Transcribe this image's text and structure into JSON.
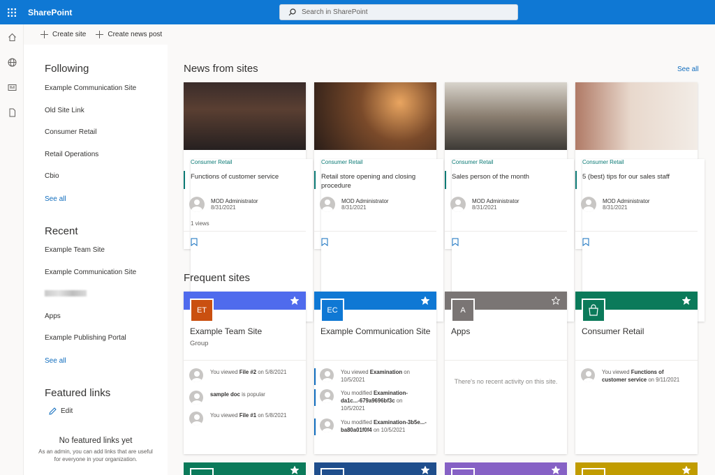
{
  "header": {
    "app_name": "SharePoint",
    "search_placeholder": "Search in SharePoint"
  },
  "rail": [
    "home-icon",
    "globe-icon",
    "news-icon",
    "document-icon"
  ],
  "command_bar": {
    "create_site": "Create site",
    "create_news": "Create news post"
  },
  "following": {
    "heading": "Following",
    "items": [
      {
        "label": "Example Communication Site",
        "starred": true
      },
      {
        "label": "Old Site Link",
        "starred": true
      },
      {
        "label": "Consumer Retail",
        "starred": true
      },
      {
        "label": "Retail Operations",
        "starred": true
      },
      {
        "label": "Cbio",
        "starred": true
      }
    ],
    "see_all": "See all"
  },
  "recent": {
    "heading": "Recent",
    "items": [
      {
        "label": "Example Team Site",
        "starred": false
      },
      {
        "label": "Example Communication Site",
        "starred": true
      },
      {
        "label": "",
        "starred": false,
        "blurred": true
      },
      {
        "label": "Apps",
        "starred": false
      },
      {
        "label": "Example Publishing Portal",
        "starred": false
      }
    ],
    "see_all": "See all"
  },
  "featured": {
    "heading": "Featured links",
    "edit": "Edit",
    "empty_title": "No featured links yet",
    "empty_desc": "As an admin, you can add links that are useful for everyone in your organization."
  },
  "news": {
    "heading": "News from sites",
    "see_all": "See all",
    "cards": [
      {
        "site": "Consumer Retail",
        "title": "Functions of customer service",
        "author": "MOD Administrator",
        "date": "8/31/2021",
        "views": "1 views"
      },
      {
        "site": "Consumer Retail",
        "title": "Retail store opening and closing procedure",
        "author": "MOD Administrator",
        "date": "8/31/2021",
        "views": ""
      },
      {
        "site": "Consumer Retail",
        "title": "Sales person of the month",
        "author": "MOD Administrator",
        "date": "8/31/2021",
        "views": ""
      },
      {
        "site": "Consumer Retail",
        "title": "5 (best) tips for our sales staff",
        "author": "MOD Administrator",
        "date": "8/31/2021",
        "views": ""
      }
    ]
  },
  "frequent": {
    "heading": "Frequent sites",
    "no_activity": "There's no recent activity on this site.",
    "sites": [
      {
        "name": "Example Team Site",
        "type": "Group",
        "initials": "ET",
        "band_color": "#4f6bed",
        "logo_color": "#ca5010"
      },
      {
        "name": "Example Communication Site",
        "type": "",
        "initials": "EC",
        "band_color": "#0f78d4",
        "logo_color": "#0f78d4"
      },
      {
        "name": "Apps",
        "type": "",
        "initials": "A",
        "band_color": "#7a7574",
        "logo_color": "#7a7574"
      },
      {
        "name": "Consumer Retail",
        "type": "",
        "initials": "",
        "band_color": "#0b7a5a",
        "logo_color": "#0b7a5a"
      }
    ],
    "activities": {
      "s0": [
        {
          "pre": "You viewed ",
          "bold": "File #2",
          "post": " on 5/8/2021"
        },
        {
          "pre": "",
          "bold": "sample doc",
          "post": " is popular"
        },
        {
          "pre": "You viewed ",
          "bold": "File #1",
          "post": " on 5/8/2021"
        }
      ],
      "s1": [
        {
          "pre": "You viewed ",
          "bold": "Examination",
          "post": " on 10/5/2021"
        },
        {
          "pre": "You modified ",
          "bold": "Examination-da1c...-679a9696bf3c",
          "post": " on 10/5/2021"
        },
        {
          "pre": "You modified ",
          "bold": "Examination-3b5e...-ba80a01f0f4",
          "post": " on 10/5/2021"
        }
      ],
      "s3": [
        {
          "pre": "You viewed ",
          "bold": "Functions of customer service",
          "post": " on 9/11/2021"
        }
      ]
    }
  },
  "peek_colors": [
    "#0b7a5a",
    "#1f4e8c",
    "#8661c5",
    "#c19c00"
  ],
  "colors": {
    "accent": "#0f78d4",
    "teal": "#0b7a75",
    "link": "#0f6cbd"
  }
}
